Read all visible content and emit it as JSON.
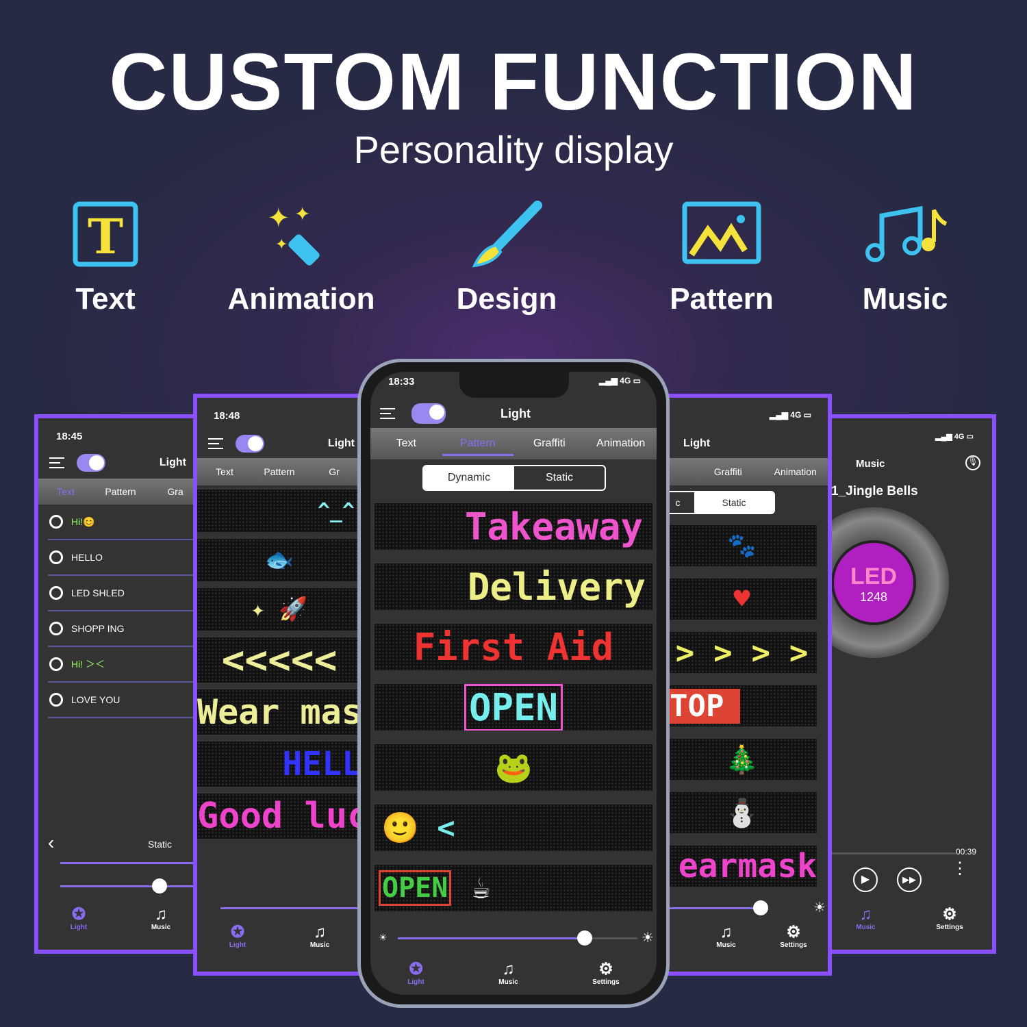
{
  "header": {
    "title": "CUSTOM FUNCTION",
    "subtitle": "Personality display"
  },
  "features": [
    {
      "label": "Text",
      "icon": "text-box-icon"
    },
    {
      "label": "Animation",
      "icon": "magic-wand-icon"
    },
    {
      "label": "Design",
      "icon": "paintbrush-icon"
    },
    {
      "label": "Pattern",
      "icon": "image-icon"
    },
    {
      "label": "Music",
      "icon": "music-notes-icon"
    }
  ],
  "colors": {
    "accent": "#8a6cf0",
    "frame": "#8a4fff",
    "tab_active": "#8a6cf0"
  },
  "phone1": {
    "time": "18:45",
    "title": "Light",
    "tabs": [
      "Text",
      "Pattern",
      "Gra"
    ],
    "items": [
      "Hi!😊",
      "HELLO",
      "LED SHLED",
      "SHOPP ING",
      "Hi! ＞＜",
      "LOVE YOU"
    ],
    "mode": "Static",
    "nav": [
      "Light",
      "Music"
    ]
  },
  "phone2": {
    "time": "18:48",
    "title": "Light",
    "tabs": [
      "Text",
      "Pattern",
      "Gr"
    ],
    "panels": [
      "^_^",
      "🐟",
      "✦ 🚀",
      "<<<<<",
      "Wear mas",
      "HELL",
      "Good luc"
    ],
    "nav": [
      "Light",
      "Music"
    ]
  },
  "center": {
    "time": "18:33",
    "signal": "4G",
    "title": "Light",
    "tabs": [
      "Text",
      "Pattern",
      "Graffiti",
      "Animation"
    ],
    "segments": [
      "Dynamic",
      "Static"
    ],
    "panels": [
      "Takeaway",
      "Delivery",
      "First Aid",
      "OPEN",
      "🐸",
      "🙂 <",
      "OPEN"
    ],
    "brightness": 0.78,
    "nav": [
      "Light",
      "Music",
      "Settings"
    ]
  },
  "phone4": {
    "signal": "4G",
    "title": "Light",
    "tabs": [
      "Graffiti",
      "Animation"
    ],
    "segments": [
      "c",
      "Static"
    ],
    "panels": [
      "🐾",
      "♥",
      "> > > >",
      "TOP",
      "🎄",
      "⛄",
      "earmask"
    ],
    "brightness": 0.62,
    "nav": [
      "Music",
      "Settings"
    ]
  },
  "phone5": {
    "signal": "4G",
    "title": "Music",
    "song": "1_Jingle Bells",
    "disc_text": "LED",
    "disc_sub": "1248",
    "time": "00:39",
    "nav": [
      "Music",
      "Settings"
    ]
  }
}
